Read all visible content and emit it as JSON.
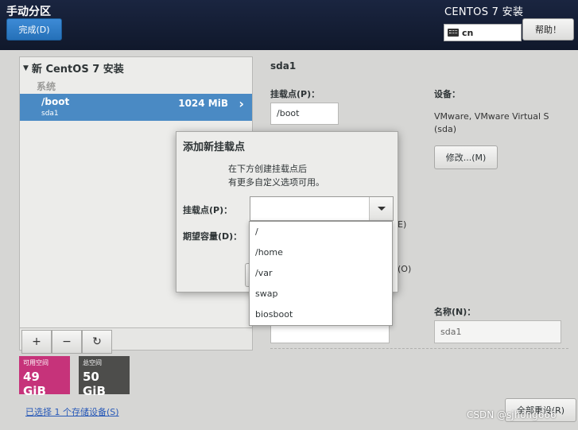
{
  "header": {
    "title": "手动分区",
    "done_label": "完成(D)",
    "product": "CENTOS 7 安装",
    "keyboard": "cn",
    "help_label": "帮助！"
  },
  "left": {
    "section_title": "新 CentOS 7 安装",
    "group_label": "系统",
    "partition": {
      "mount": "/boot",
      "device": "sda1",
      "size": "1024 MiB"
    },
    "toolbar": {
      "add": "+",
      "remove": "−",
      "refresh": "↻"
    },
    "available": {
      "label": "可用空间",
      "value": "49 GiB"
    },
    "total": {
      "label": "总空间",
      "value": "50 GiB"
    },
    "storage_link": "已选择 1 个存储设备(S)"
  },
  "right": {
    "title": "sda1",
    "mount_label": "挂载点(P)：",
    "mount_value": "/boot",
    "device_label": "设备：",
    "device_value_line1": "VMware, VMware Virtual S",
    "device_value_line2": "(sda)",
    "modify_label": "修改...(M)",
    "partial_e": "E)",
    "partial_o": "(O)",
    "name_label": "名称(N)：",
    "name_value": "sda1",
    "reset_label": "全部重设(R)"
  },
  "dialog": {
    "title": "添加新挂载点",
    "desc_line1": "在下方创建挂载点后",
    "desc_line2": "有更多自定义选项可用。",
    "mount_label": "挂载点(P)：",
    "capacity_label": "期望容量(D)："
  },
  "dropdown": {
    "items": [
      "/",
      "/home",
      "/var",
      "swap",
      "biosboot"
    ]
  },
  "watermark": "CSDN @sjhong666"
}
